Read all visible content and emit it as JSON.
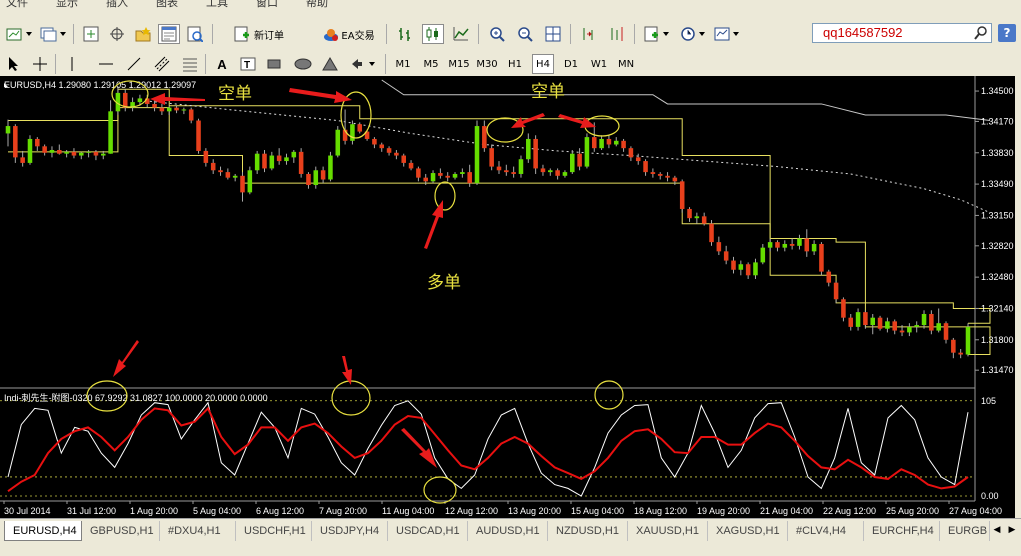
{
  "menubar": {
    "items": [
      "文件",
      "显示",
      "插入",
      "图表",
      "工具",
      "窗口",
      "帮助"
    ]
  },
  "toolbar": {
    "new_order_label": "新订单",
    "ea_label": "EA交易",
    "timeframes": [
      "M1",
      "M5",
      "M15",
      "M30",
      "H1",
      "H4",
      "D1",
      "W1",
      "MN"
    ],
    "active_timeframe": "H4",
    "search_value": "qq164587592",
    "help_label": "?"
  },
  "main_chart": {
    "header": "EURUSD,H4  1.29080 1.29105 1.29012 1.29097",
    "price_ticks": [
      "1.34500",
      "1.34170",
      "1.33830",
      "1.33490",
      "1.33150",
      "1.32820",
      "1.32480",
      "1.32140",
      "1.31800",
      "1.31470"
    ],
    "annotations": [
      "空单",
      "空单",
      "多单"
    ],
    "colors": {
      "bull": "#66dd00",
      "bear": "#e8401c",
      "wick": "#aaaaaa",
      "band": "#e8e060",
      "trail": "#c8c8c8",
      "ma": "#dddddd",
      "arrow": "#e81c1c",
      "annotation": "#e8e040"
    }
  },
  "indicator": {
    "header": "Indi-刺先生-附图-0320 67.9292 31.0827 100.0000 20.0000 0.0000",
    "scale_ticks": [
      "105",
      "0.00"
    ],
    "colors": {
      "fast": "#ffffff",
      "slow": "#e81010",
      "levels": "#cccc44"
    }
  },
  "time_axis": [
    "30 Jul 2014",
    "31 Jul 12:00",
    "1 Aug 20:00",
    "5 Aug 04:00",
    "6 Aug 12:00",
    "7 Aug 20:00",
    "11 Aug 04:00",
    "12 Aug 12:00",
    "13 Aug 20:00",
    "15 Aug 04:00",
    "18 Aug 12:00",
    "19 Aug 20:00",
    "21 Aug 04:00",
    "22 Aug 12:00",
    "25 Aug 20:00",
    "27 Aug 04:00"
  ],
  "tabs": [
    "EURUSD,H4",
    "GBPUSD,H1",
    "#DXU4,H1",
    "USDCHF,H1",
    "USDJPY,H4",
    "USDCAD,H1",
    "AUDUSD,H1",
    "NZDUSD,H1",
    "XAUUSD,H1",
    "XAGUSD,H1",
    "#CLV4,H4",
    "EURCHF,H4",
    "EURGB"
  ],
  "chart_data": [
    {
      "type": "candlestick",
      "title": "EURUSD,H4",
      "ylim": [
        1.3132,
        1.3462
      ],
      "candles": [
        [
          1.3404,
          1.3419,
          1.339,
          1.3412
        ],
        [
          1.3412,
          1.3414,
          1.3372,
          1.3378
        ],
        [
          1.3378,
          1.3385,
          1.3368,
          1.3372
        ],
        [
          1.3372,
          1.3402,
          1.337,
          1.3398
        ],
        [
          1.3398,
          1.34,
          1.3385,
          1.339
        ],
        [
          1.339,
          1.3392,
          1.338,
          1.3383
        ],
        [
          1.3383,
          1.339,
          1.3378,
          1.3386
        ],
        [
          1.3386,
          1.3392,
          1.3381,
          1.3382
        ],
        [
          1.3382,
          1.3386,
          1.3378,
          1.3384
        ],
        [
          1.3384,
          1.3388,
          1.3377,
          1.338
        ],
        [
          1.338,
          1.3384,
          1.3376,
          1.3383
        ],
        [
          1.3383,
          1.3386,
          1.3378,
          1.3384
        ],
        [
          1.3384,
          1.3386,
          1.3375,
          1.338
        ],
        [
          1.338,
          1.3385,
          1.3376,
          1.3382
        ],
        [
          1.3382,
          1.344,
          1.3382,
          1.3428
        ],
        [
          1.3428,
          1.3455,
          1.3424,
          1.3448
        ],
        [
          1.3448,
          1.3452,
          1.3428,
          1.3432
        ],
        [
          1.3432,
          1.3443,
          1.3428,
          1.3438
        ],
        [
          1.3438,
          1.3446,
          1.3434,
          1.3442
        ],
        [
          1.3442,
          1.3446,
          1.3432,
          1.3436
        ],
        [
          1.3436,
          1.3442,
          1.3428,
          1.3432
        ],
        [
          1.3432,
          1.3436,
          1.3424,
          1.3428
        ],
        [
          1.3428,
          1.3434,
          1.3424,
          1.3432
        ],
        [
          1.3432,
          1.3434,
          1.3426,
          1.3429
        ],
        [
          1.3429,
          1.3432,
          1.3425,
          1.343
        ],
        [
          1.343,
          1.3432,
          1.3415,
          1.3418
        ],
        [
          1.3418,
          1.342,
          1.3382,
          1.3385
        ],
        [
          1.3385,
          1.3388,
          1.3368,
          1.3372
        ],
        [
          1.3372,
          1.3376,
          1.336,
          1.3364
        ],
        [
          1.3364,
          1.3368,
          1.3358,
          1.3362
        ],
        [
          1.3362,
          1.3366,
          1.3354,
          1.3356
        ],
        [
          1.3356,
          1.336,
          1.3352,
          1.3358
        ],
        [
          1.3358,
          1.3362,
          1.333,
          1.334
        ],
        [
          1.334,
          1.3368,
          1.3338,
          1.3364
        ],
        [
          1.3364,
          1.3385,
          1.336,
          1.3382
        ],
        [
          1.3382,
          1.3386,
          1.3362,
          1.3366
        ],
        [
          1.3366,
          1.3384,
          1.3364,
          1.338
        ],
        [
          1.338,
          1.3388,
          1.337,
          1.3374
        ],
        [
          1.3374,
          1.3382,
          1.337,
          1.3378
        ],
        [
          1.3378,
          1.3386,
          1.3372,
          1.3384
        ],
        [
          1.3384,
          1.3388,
          1.3356,
          1.336
        ],
        [
          1.336,
          1.3362,
          1.3344,
          1.3348
        ],
        [
          1.3348,
          1.3368,
          1.3344,
          1.3364
        ],
        [
          1.3364,
          1.3368,
          1.335,
          1.3354
        ],
        [
          1.3354,
          1.3384,
          1.3352,
          1.338
        ],
        [
          1.338,
          1.3412,
          1.3378,
          1.3408
        ],
        [
          1.3408,
          1.343,
          1.3392,
          1.3396
        ],
        [
          1.3396,
          1.3418,
          1.3392,
          1.3414
        ],
        [
          1.3414,
          1.3416,
          1.3404,
          1.3406
        ],
        [
          1.3406,
          1.3408,
          1.3396,
          1.3398
        ],
        [
          1.3398,
          1.34,
          1.3388,
          1.3392
        ],
        [
          1.3392,
          1.3394,
          1.3384,
          1.3388
        ],
        [
          1.3388,
          1.339,
          1.338,
          1.3383
        ],
        [
          1.3383,
          1.3386,
          1.3376,
          1.338
        ],
        [
          1.338,
          1.3382,
          1.3368,
          1.3372
        ],
        [
          1.3372,
          1.3375,
          1.3364,
          1.3366
        ],
        [
          1.3366,
          1.3368,
          1.3352,
          1.3356
        ],
        [
          1.3356,
          1.336,
          1.3348,
          1.3352
        ],
        [
          1.3352,
          1.3364,
          1.335,
          1.3361
        ],
        [
          1.3361,
          1.3366,
          1.3355,
          1.3358
        ],
        [
          1.3358,
          1.3362,
          1.3352,
          1.3356
        ],
        [
          1.3356,
          1.3362,
          1.3354,
          1.336
        ],
        [
          1.336,
          1.3366,
          1.3356,
          1.3362
        ],
        [
          1.3362,
          1.337,
          1.3346,
          1.335
        ],
        [
          1.335,
          1.3418,
          1.3348,
          1.3412
        ],
        [
          1.3412,
          1.3418,
          1.3384,
          1.3388
        ],
        [
          1.3388,
          1.3392,
          1.3364,
          1.3368
        ],
        [
          1.3368,
          1.3374,
          1.336,
          1.3364
        ],
        [
          1.3364,
          1.337,
          1.3358,
          1.3362
        ],
        [
          1.3362,
          1.3368,
          1.3356,
          1.336
        ],
        [
          1.336,
          1.338,
          1.3356,
          1.3376
        ],
        [
          1.3376,
          1.3404,
          1.3372,
          1.3398
        ],
        [
          1.3398,
          1.3402,
          1.336,
          1.3366
        ],
        [
          1.3366,
          1.337,
          1.3358,
          1.3362
        ],
        [
          1.3362,
          1.3366,
          1.3358,
          1.3364
        ],
        [
          1.3364,
          1.3366,
          1.3354,
          1.3358
        ],
        [
          1.3358,
          1.3364,
          1.3356,
          1.3362
        ],
        [
          1.3362,
          1.3386,
          1.336,
          1.3382
        ],
        [
          1.3382,
          1.3388,
          1.3364,
          1.3368
        ],
        [
          1.3368,
          1.3404,
          1.3366,
          1.34
        ],
        [
          1.34,
          1.3416,
          1.3384,
          1.3388
        ],
        [
          1.3388,
          1.3402,
          1.3386,
          1.3398
        ],
        [
          1.3398,
          1.3402,
          1.3388,
          1.3392
        ],
        [
          1.3392,
          1.34,
          1.339,
          1.3396
        ],
        [
          1.3396,
          1.3398,
          1.3384,
          1.3388
        ],
        [
          1.3388,
          1.339,
          1.3374,
          1.3378
        ],
        [
          1.3378,
          1.3382,
          1.337,
          1.3374
        ],
        [
          1.3374,
          1.3376,
          1.3358,
          1.3362
        ],
        [
          1.3362,
          1.3366,
          1.3356,
          1.336
        ],
        [
          1.336,
          1.3362,
          1.3354,
          1.3358
        ],
        [
          1.3358,
          1.3362,
          1.3352,
          1.3356
        ],
        [
          1.3356,
          1.3358,
          1.3348,
          1.3352
        ],
        [
          1.3352,
          1.3354,
          1.3318,
          1.3322
        ],
        [
          1.3322,
          1.3324,
          1.3308,
          1.3312
        ],
        [
          1.3312,
          1.3318,
          1.3306,
          1.3314
        ],
        [
          1.3314,
          1.3318,
          1.3304,
          1.3306
        ],
        [
          1.3306,
          1.331,
          1.3282,
          1.3286
        ],
        [
          1.3286,
          1.3292,
          1.3272,
          1.3276
        ],
        [
          1.3276,
          1.3282,
          1.3262,
          1.3266
        ],
        [
          1.3266,
          1.327,
          1.3252,
          1.3256
        ],
        [
          1.3256,
          1.3266,
          1.325,
          1.3262
        ],
        [
          1.3262,
          1.3264,
          1.3246,
          1.325
        ],
        [
          1.325,
          1.3268,
          1.3246,
          1.3264
        ],
        [
          1.3264,
          1.3284,
          1.3262,
          1.328
        ],
        [
          1.328,
          1.329,
          1.3276,
          1.3286
        ],
        [
          1.3286,
          1.3288,
          1.3276,
          1.328
        ],
        [
          1.328,
          1.3288,
          1.3276,
          1.3284
        ],
        [
          1.3284,
          1.329,
          1.3278,
          1.3282
        ],
        [
          1.3282,
          1.3294,
          1.3278,
          1.329
        ],
        [
          1.329,
          1.33,
          1.327,
          1.3276
        ],
        [
          1.3276,
          1.3288,
          1.3272,
          1.3284
        ],
        [
          1.3284,
          1.3286,
          1.325,
          1.3254
        ],
        [
          1.3254,
          1.3256,
          1.3238,
          1.3242
        ],
        [
          1.3242,
          1.3244,
          1.322,
          1.3224
        ],
        [
          1.3224,
          1.3226,
          1.32,
          1.3204
        ],
        [
          1.3204,
          1.3208,
          1.319,
          1.3194
        ],
        [
          1.3194,
          1.3214,
          1.319,
          1.321
        ],
        [
          1.321,
          1.3212,
          1.3192,
          1.3196
        ],
        [
          1.3196,
          1.3208,
          1.3186,
          1.3204
        ],
        [
          1.3204,
          1.3206,
          1.319,
          1.3192
        ],
        [
          1.3192,
          1.3204,
          1.3188,
          1.32
        ],
        [
          1.32,
          1.3202,
          1.3186,
          1.319
        ],
        [
          1.319,
          1.3196,
          1.3184,
          1.3188
        ],
        [
          1.3188,
          1.3198,
          1.3184,
          1.3194
        ],
        [
          1.3194,
          1.32,
          1.3188,
          1.3196
        ],
        [
          1.3196,
          1.3212,
          1.3192,
          1.3208
        ],
        [
          1.3208,
          1.3212,
          1.3186,
          1.319
        ],
        [
          1.319,
          1.3214,
          1.3188,
          1.3198
        ],
        [
          1.3198,
          1.32,
          1.3176,
          1.318
        ],
        [
          1.318,
          1.3182,
          1.316,
          1.3166
        ],
        [
          1.3166,
          1.317,
          1.316,
          1.3164
        ],
        [
          1.3164,
          1.3198,
          1.3162,
          1.3194
        ]
      ],
      "band": [
        {
          "x": 0,
          "upper": 1.3418,
          "lower": 1.3384
        },
        {
          "x": 14,
          "upper": 1.3418,
          "lower": 1.3384
        },
        {
          "x": 15,
          "upper": 1.3452,
          "lower": 1.3432
        },
        {
          "x": 22,
          "upper": 1.3434,
          "lower": 1.338
        },
        {
          "x": 32,
          "upper": 1.3434,
          "lower": 1.335
        },
        {
          "x": 47,
          "upper": 1.3434,
          "lower": 1.335
        },
        {
          "x": 48,
          "upper": 1.342,
          "lower": 1.335
        },
        {
          "x": 91,
          "upper": 1.342,
          "lower": 1.335
        },
        {
          "x": 92,
          "upper": 1.338,
          "lower": 1.3306
        },
        {
          "x": 104,
          "upper": 1.329,
          "lower": 1.325
        },
        {
          "x": 112,
          "upper": 1.329,
          "lower": 1.325
        },
        {
          "x": 113,
          "upper": 1.3286,
          "lower": 1.322
        },
        {
          "x": 117,
          "upper": 1.322,
          "lower": 1.3194
        },
        {
          "x": 129,
          "upper": 1.3214,
          "lower": 1.3194
        },
        {
          "x": 134,
          "upper": 1.3198,
          "lower": 1.3164
        }
      ],
      "trail_upper": [
        {
          "x": 51,
          "y": 1.3462
        },
        {
          "x": 54,
          "y": 1.3446
        },
        {
          "x": 60,
          "y": 1.3446
        },
        {
          "x": 88,
          "y": 1.3446
        },
        {
          "x": 90,
          "y": 1.3436
        },
        {
          "x": 111,
          "y": 1.3436
        },
        {
          "x": 117,
          "y": 1.3424
        },
        {
          "x": 128,
          "y": 1.3424
        },
        {
          "x": 134,
          "y": 1.3418
        }
      ],
      "ma": [
        {
          "x": 18,
          "y": 1.344
        },
        {
          "x": 30,
          "y": 1.343
        },
        {
          "x": 45,
          "y": 1.3418
        },
        {
          "x": 55,
          "y": 1.3404
        },
        {
          "x": 65,
          "y": 1.3392
        },
        {
          "x": 75,
          "y": 1.3385
        },
        {
          "x": 85,
          "y": 1.338
        },
        {
          "x": 95,
          "y": 1.3374
        },
        {
          "x": 105,
          "y": 1.3368
        },
        {
          "x": 115,
          "y": 1.336
        },
        {
          "x": 125,
          "y": 1.3344
        },
        {
          "x": 130,
          "y": 1.3332
        },
        {
          "x": 134,
          "y": 1.3318
        }
      ]
    },
    {
      "type": "line",
      "title": "Indi-刺先生-附图-0320",
      "ylim": [
        0,
        105
      ],
      "levels": [
        100,
        20,
        0
      ],
      "series": [
        {
          "values": [
            20,
            75,
            92,
            90,
            45,
            72,
            68,
            45,
            30,
            55,
            85,
            98,
            96,
            60,
            80,
            98,
            35,
            22,
            55,
            88,
            72,
            40,
            92,
            86,
            62,
            35,
            22,
            50,
            74,
            95,
            100,
            86,
            40,
            18,
            8,
            22,
            60,
            85,
            92,
            55,
            24,
            12,
            8,
            0,
            30,
            66,
            85,
            95,
            96,
            40,
            20,
            45,
            95,
            66,
            30,
            48,
            82,
            97,
            98,
            62,
            20,
            8,
            40,
            92,
            35,
            22,
            82,
            95,
            80,
            40,
            20,
            12,
            88
          ]
        },
        {
          "values": [
            5,
            15,
            22,
            45,
            60,
            68,
            72,
            62,
            48,
            62,
            80,
            92,
            90,
            74,
            78,
            92,
            62,
            44,
            54,
            72,
            72,
            58,
            72,
            76,
            66,
            52,
            40,
            45,
            58,
            75,
            84,
            82,
            65,
            48,
            32,
            28,
            40,
            55,
            62,
            55,
            42,
            30,
            24,
            18,
            26,
            40,
            58,
            68,
            70,
            60,
            46,
            45,
            62,
            62,
            54,
            54,
            66,
            76,
            72,
            58,
            42,
            30,
            28,
            38,
            30,
            20,
            18,
            28,
            22,
            12,
            8,
            10,
            20
          ]
        }
      ]
    }
  ]
}
